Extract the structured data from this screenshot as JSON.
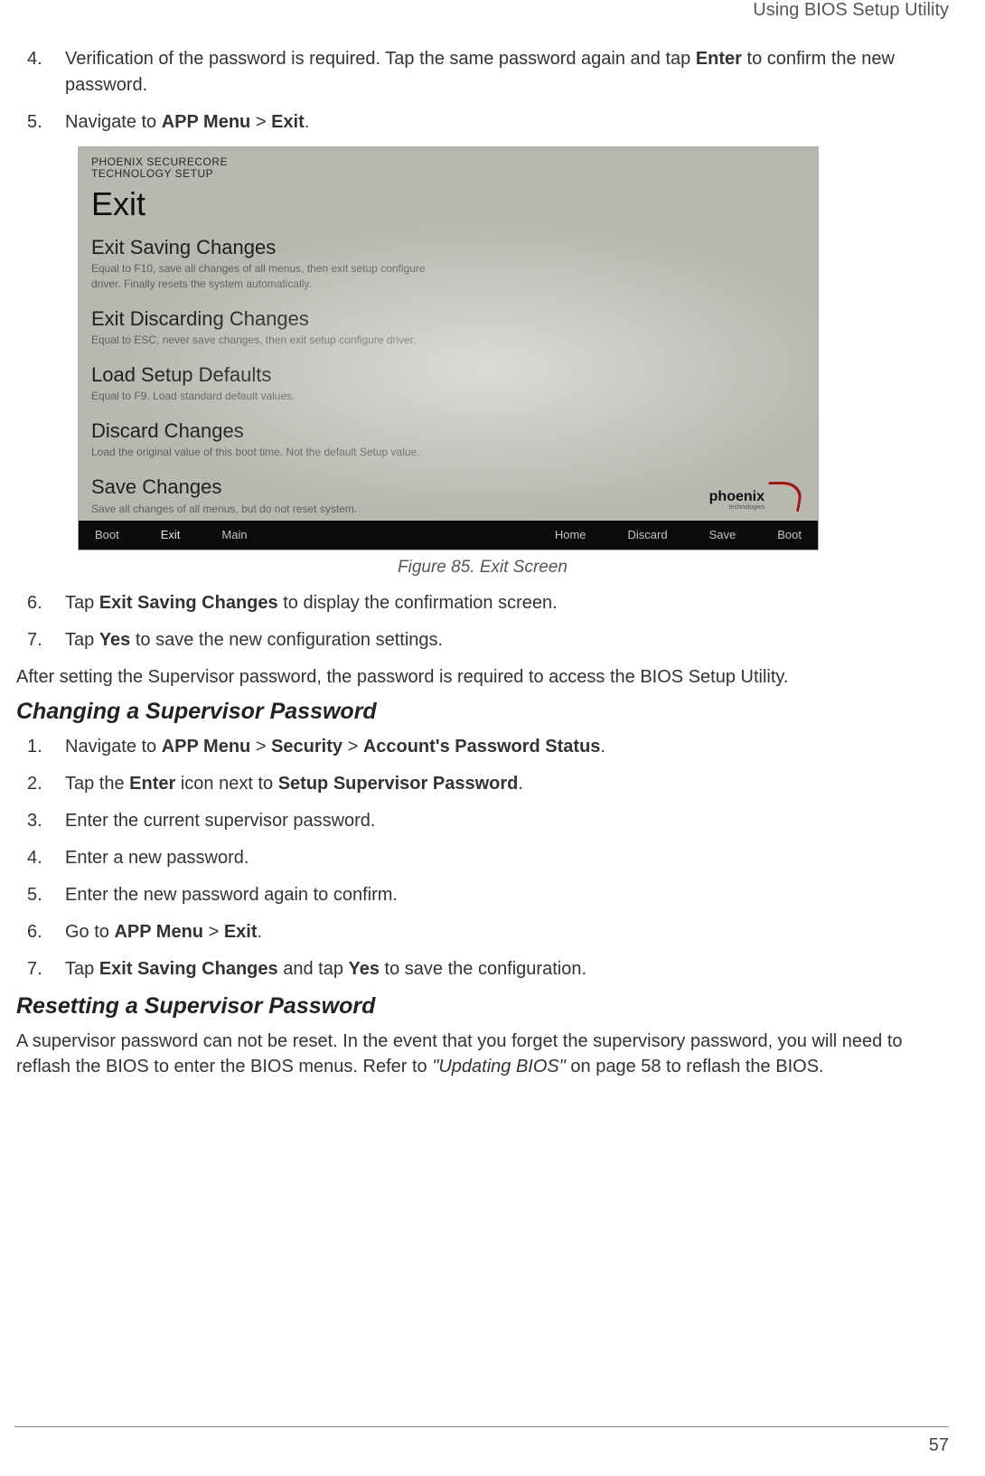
{
  "header": {
    "right": "Using BIOS Setup Utility"
  },
  "intro_steps": [
    {
      "n": "4.",
      "parts": [
        "Verification of the password is required. Tap the same password again and tap ",
        {
          "b": "Enter"
        },
        " to confirm the new password."
      ]
    },
    {
      "n": "5.",
      "parts": [
        "Navigate to ",
        {
          "b": "APP Menu"
        },
        " > ",
        {
          "b": "Exit"
        },
        "."
      ]
    }
  ],
  "bios": {
    "label_line1": "PHOENIX SECURECORE",
    "label_line2": "TECHNOLOGY SETUP",
    "title": "Exit",
    "options": [
      {
        "title": "Exit Saving Changes",
        "desc": "Equal to F10, save all changes of all menus, then exit setup configure driver. Finally resets the system automatically."
      },
      {
        "title": "Exit Discarding Changes",
        "desc": "Equal to ESC, never save changes, then exit setup configure driver."
      },
      {
        "title": "Load Setup Defaults",
        "desc": "Equal to F9. Load standard default values."
      },
      {
        "title": "Discard Changes",
        "desc": "Load the original value of this boot time. Not the default Setup value."
      },
      {
        "title": "Save Changes",
        "desc": "Save all changes of all menus, but do not reset system."
      }
    ],
    "tabs_left": [
      "Boot",
      "Exit",
      "Main"
    ],
    "tabs_right": [
      "Home",
      "Discard",
      "Save",
      "Boot"
    ],
    "logo_text": "phoenix",
    "logo_sub": "technologies"
  },
  "figure_caption": "Figure 85.  Exit Screen",
  "post_figure_steps": [
    {
      "n": "6.",
      "parts": [
        "Tap ",
        {
          "b": "Exit Saving Changes"
        },
        " to display the confirmation screen."
      ]
    },
    {
      "n": "7.",
      "parts": [
        "Tap ",
        {
          "b": "Yes"
        },
        " to save the new configuration settings."
      ]
    }
  ],
  "after_para": "After setting the Supervisor password, the password is required to access the BIOS Setup Utility.",
  "section_change": "Changing a Supervisor Password",
  "change_steps": [
    {
      "n": "1.",
      "parts": [
        "Navigate to ",
        {
          "b": "APP Menu"
        },
        " > ",
        {
          "b": "Security"
        },
        " > ",
        {
          "b": "Account's Password Status"
        },
        "."
      ]
    },
    {
      "n": "2.",
      "parts": [
        "Tap the ",
        {
          "b": "Enter"
        },
        " icon next to ",
        {
          "b": "Setup Supervisor Password"
        },
        "."
      ]
    },
    {
      "n": "3.",
      "parts": [
        "Enter the current supervisor password."
      ]
    },
    {
      "n": "4.",
      "parts": [
        "Enter a new password."
      ]
    },
    {
      "n": "5.",
      "parts": [
        "Enter the new password again to confirm."
      ]
    },
    {
      "n": "6.",
      "parts": [
        "Go to ",
        {
          "b": "APP Menu"
        },
        " > ",
        {
          "b": "Exit"
        },
        "."
      ]
    },
    {
      "n": "7.",
      "parts": [
        "Tap ",
        {
          "b": "Exit Saving Changes"
        },
        " and tap ",
        {
          "b": "Yes"
        },
        " to save the configuration."
      ]
    }
  ],
  "section_reset": "Resetting a Supervisor Password",
  "reset_para_parts": [
    "A supervisor password can not be reset. In the event that you forget the supervisory password, you will need to reflash the BIOS to enter the BIOS menus. Refer to ",
    {
      "i": "\"Updating BIOS\""
    },
    " on page 58 to reflash the BIOS."
  ],
  "page_number": "57"
}
